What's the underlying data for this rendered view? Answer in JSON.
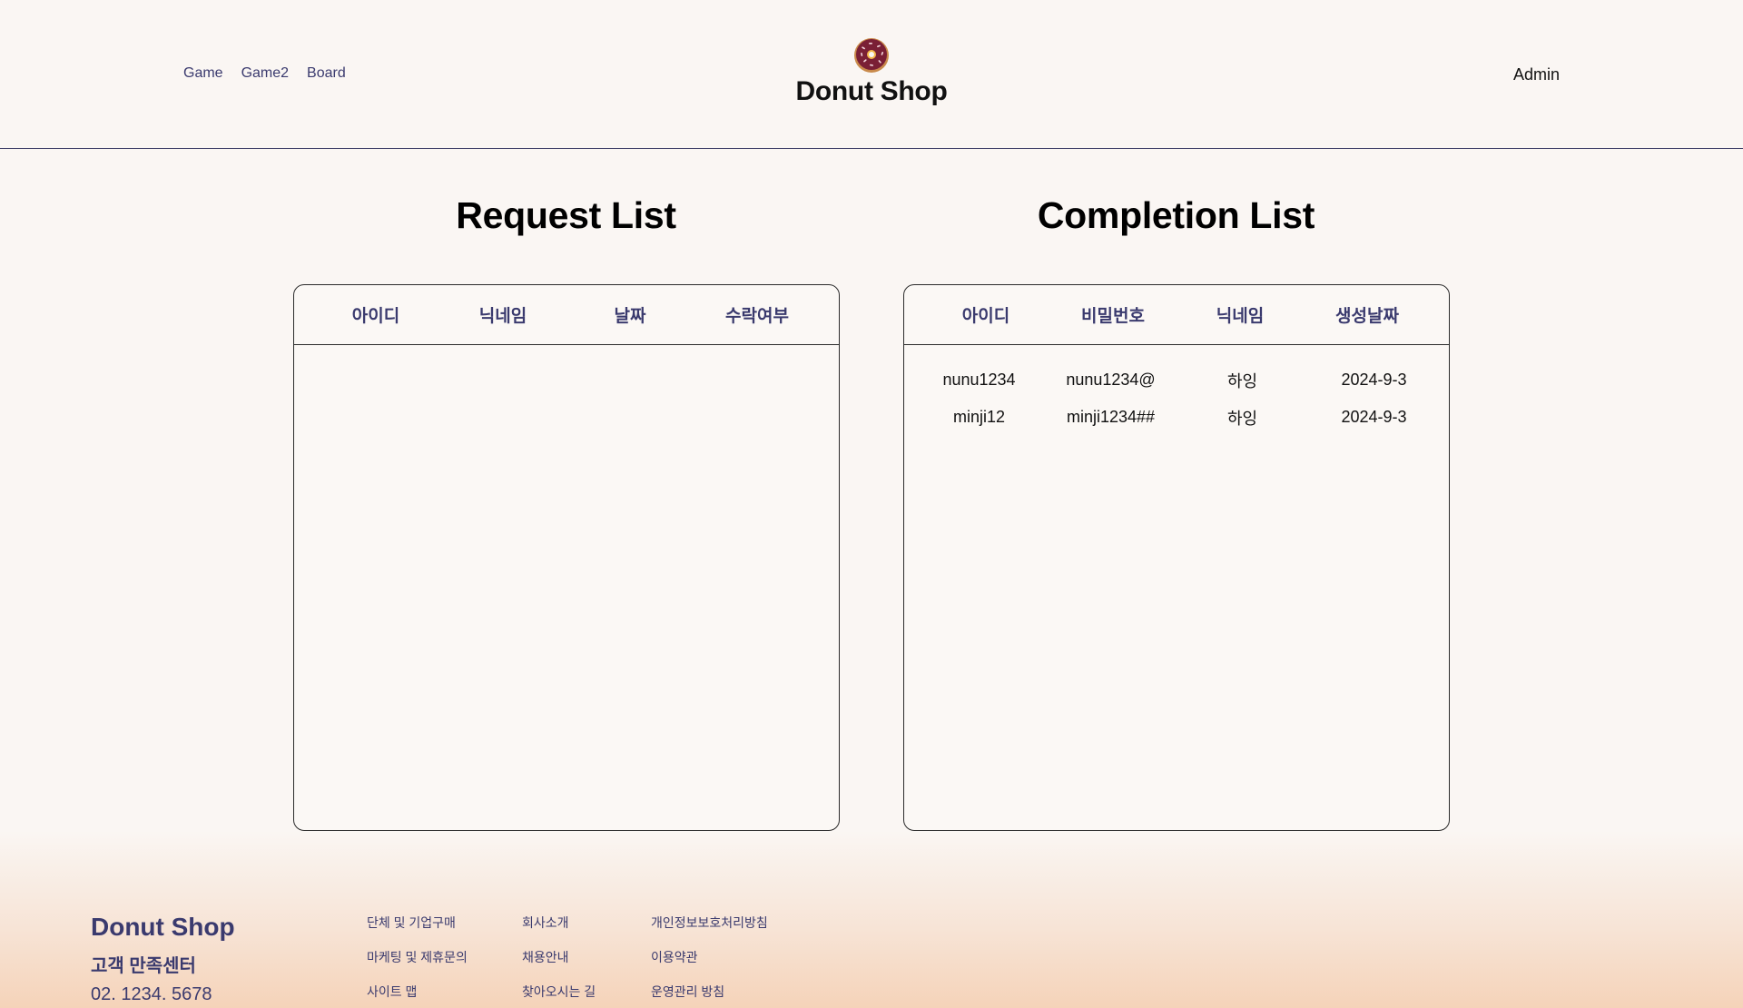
{
  "header": {
    "nav": [
      "Game",
      "Game2",
      "Board"
    ],
    "brand_title": "Donut Shop",
    "admin_label": "Admin"
  },
  "request": {
    "title": "Request List",
    "columns": [
      "아이디",
      "닉네임",
      "날짜",
      "수락여부"
    ],
    "rows": []
  },
  "completion": {
    "title": "Completion List",
    "columns": [
      "아이디",
      "비밀번호",
      "닉네임",
      "생성날짜"
    ],
    "rows": [
      [
        "nunu1234",
        "nunu1234@",
        "하잉",
        "2024-9-3"
      ],
      [
        "minji12",
        "minji1234##",
        "하잉",
        "2024-9-3"
      ]
    ]
  },
  "footer": {
    "brand": "Donut Shop",
    "center_label": "고객 만족센터",
    "phone": "02. 1234. 5678",
    "col1": [
      "단체 및 기업구매",
      "마케팅 및 제휴문의",
      "사이트 맵"
    ],
    "col2": [
      "회사소개",
      "채용안내",
      "찾아오시는 길"
    ],
    "col3": [
      "개인정보보호처리방침",
      "이용약관",
      "운영관리 방침"
    ]
  },
  "icons": {
    "logo": "donut-icon"
  },
  "colors": {
    "accent": "#3a3a6e",
    "background": "#faf6f3",
    "footer_gradient_end": "#f5d3b9"
  }
}
